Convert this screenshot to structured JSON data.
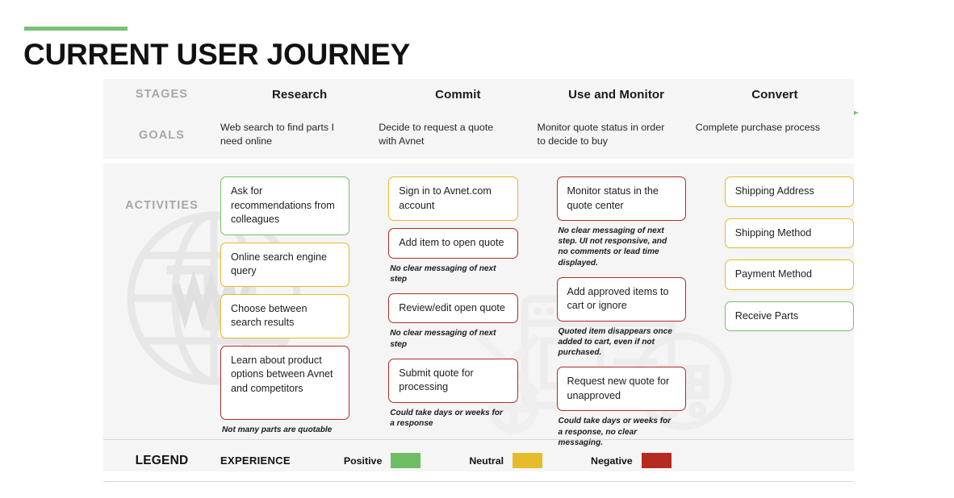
{
  "page": {
    "title": "CURRENT USER JOURNEY",
    "accent_color": "#7AC074"
  },
  "colors": {
    "positive": "#6FBE65",
    "neutral": "#E5BC2A",
    "negative": "#B52B22",
    "panel_bg": "#F5F5F5"
  },
  "row_labels": {
    "stages": "STAGES",
    "goals": "GOALS",
    "activities": "ACTIVITIES"
  },
  "stages": [
    {
      "name": "Research"
    },
    {
      "name": "Commit"
    },
    {
      "name": "Use and Monitor"
    },
    {
      "name": "Convert"
    }
  ],
  "goals": [
    "Web search to find parts I need online",
    "Decide to request a quote with Avnet",
    "Monitor quote status in order to decide to buy",
    "Complete purchase process"
  ],
  "activities": {
    "research": [
      {
        "text": "Ask for recommendations from colleagues",
        "sentiment": "green",
        "note": ""
      },
      {
        "text": "Online search engine query",
        "sentiment": "yellow",
        "note": ""
      },
      {
        "text": "Choose between search results",
        "sentiment": "yellow",
        "note": ""
      },
      {
        "text": "Learn about product options between Avnet and competitors",
        "sentiment": "red",
        "note": "Not many parts are quotable"
      }
    ],
    "commit": [
      {
        "text": "Sign in to Avnet.com account",
        "sentiment": "yellow",
        "note": ""
      },
      {
        "text": "Add item to open quote",
        "sentiment": "red",
        "note": "No clear messaging of next step"
      },
      {
        "text": "Review/edit open quote",
        "sentiment": "red",
        "note": "No clear messaging of next step"
      },
      {
        "text": "Submit quote for processing",
        "sentiment": "red",
        "note": "Could take days or weeks for a response"
      }
    ],
    "use_and_monitor": [
      {
        "text": "Monitor status in the quote center",
        "sentiment": "red",
        "note": "No clear messaging of next step. UI not responsive, and no comments or lead time displayed."
      },
      {
        "text": "Add approved items to cart or ignore",
        "sentiment": "red",
        "note": "Quoted item disappears once added to cart, even if not purchased."
      },
      {
        "text": "Request new quote for unapproved",
        "sentiment": "red",
        "note": "Could take days or weeks for a response, no clear messaging."
      }
    ],
    "convert": [
      {
        "text": "Shipping Address",
        "sentiment": "yellow",
        "note": ""
      },
      {
        "text": "Shipping Method",
        "sentiment": "yellow",
        "note": ""
      },
      {
        "text": "Payment Method",
        "sentiment": "yellow",
        "note": ""
      },
      {
        "text": "Receive Parts",
        "sentiment": "green",
        "note": ""
      }
    ]
  },
  "legend": {
    "title": "LEGEND",
    "category": "EXPERIENCE",
    "items": [
      {
        "label": "Positive",
        "swatch": "green"
      },
      {
        "label": "Neutral",
        "swatch": "yellow"
      },
      {
        "label": "Negative",
        "swatch": "red"
      }
    ]
  }
}
